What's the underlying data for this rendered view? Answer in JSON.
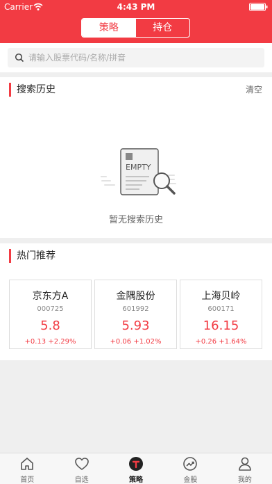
{
  "status_bar": {
    "carrier": "Carrier",
    "time": "4:43 PM"
  },
  "header": {
    "tabs": [
      "策略",
      "持仓"
    ]
  },
  "search": {
    "placeholder": "请输入股票代码/名称/拼音"
  },
  "history": {
    "title": "搜索历史",
    "clear_label": "清空",
    "empty_badge": "EMPTY",
    "empty_text": "暂无搜索历史"
  },
  "hot": {
    "title": "热门推荐",
    "stocks": [
      {
        "name": "京东方A",
        "code": "000725",
        "price": "5.8",
        "change": "+0.13  +2.29%"
      },
      {
        "name": "金隅股份",
        "code": "601992",
        "price": "5.93",
        "change": "+0.06  +1.02%"
      },
      {
        "name": "上海贝岭",
        "code": "600171",
        "price": "16.15",
        "change": "+0.26  +1.64%"
      }
    ]
  },
  "tabbar": {
    "items": [
      {
        "label": "首页",
        "icon": "home-icon"
      },
      {
        "label": "自选",
        "icon": "heart-icon"
      },
      {
        "label": "策略",
        "icon": "strategy-icon"
      },
      {
        "label": "金股",
        "icon": "trend-icon"
      },
      {
        "label": "我的",
        "icon": "user-icon"
      }
    ]
  },
  "colors": {
    "accent": "#f23b43",
    "background": "#efefef"
  }
}
